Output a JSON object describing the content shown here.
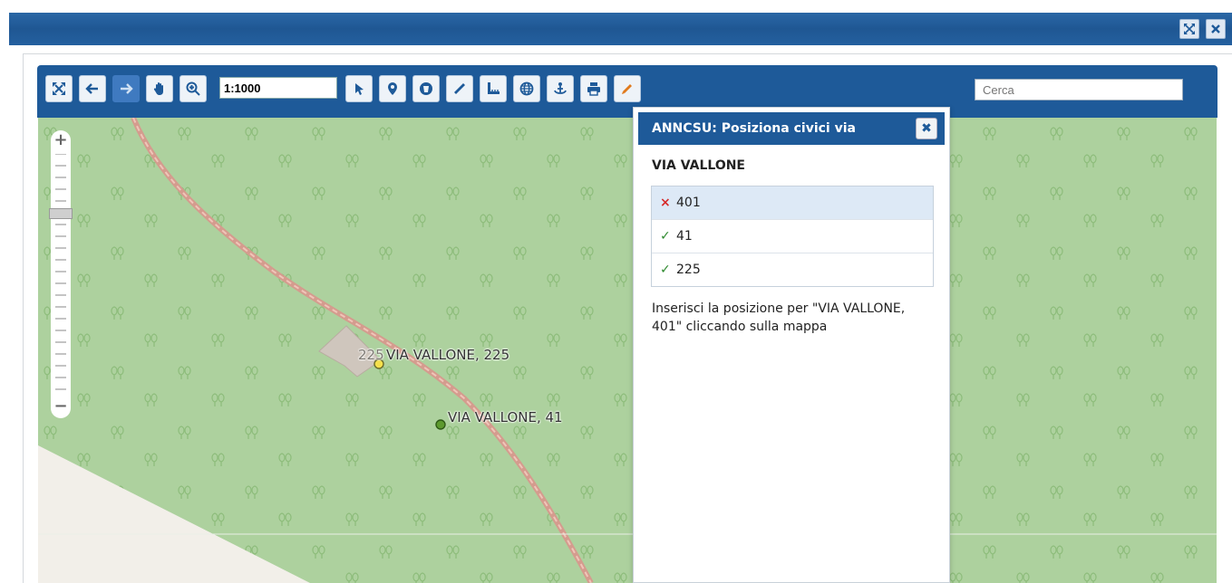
{
  "window": {
    "title": ""
  },
  "toolbar": {
    "scale_value": "1:1000",
    "search_placeholder": "Cerca",
    "buttons": [
      {
        "icon": "fullscreen-icon"
      },
      {
        "icon": "arrow-left-icon"
      },
      {
        "icon": "arrow-right-icon"
      },
      {
        "icon": "hand-pan-icon"
      },
      {
        "icon": "zoom-in-icon"
      },
      {
        "icon": "pointer-icon"
      },
      {
        "icon": "map-marker-icon"
      },
      {
        "icon": "layers-icon"
      },
      {
        "icon": "ruler-icon"
      },
      {
        "icon": "measure-area-icon"
      },
      {
        "icon": "globe-icon"
      },
      {
        "icon": "anchor-icon"
      },
      {
        "icon": "print-icon"
      },
      {
        "icon": "pencil-icon"
      }
    ]
  },
  "map": {
    "labels": [
      "VIA VALLONE, 225",
      "VIA VALLONE, 41"
    ],
    "building_number": "225",
    "colors": {
      "forest": "#add19e",
      "path": "#e89c8c",
      "point_selected": "#f5e04c",
      "point_ok": "#5d9a2e"
    }
  },
  "dialog": {
    "title": "ANNCSU: Posiziona civici via",
    "street": "VIA VALLONE",
    "items": [
      {
        "number": "401",
        "status": "×",
        "state": "missing"
      },
      {
        "number": "41",
        "status": "✓",
        "state": "ok"
      },
      {
        "number": "225",
        "status": "✓",
        "state": "ok"
      }
    ],
    "instructions": "Inserisci la posizione per \"VIA VALLONE, 401\" cliccando sulla mappa"
  }
}
